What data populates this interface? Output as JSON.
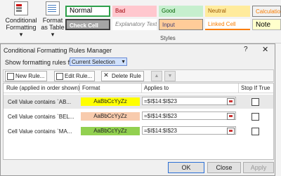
{
  "ribbon": {
    "conditional_formatting": "Conditional Formatting",
    "cf_caret": "▾",
    "format_as_table": "Format as Table",
    "ft_caret": "▾",
    "styles_group_label": "Styles",
    "styles": [
      {
        "label": "Normal",
        "bg": "#ffffff",
        "fg": "#000000",
        "border": "#2e9f4a"
      },
      {
        "label": "Bad",
        "bg": "#ffc7ce",
        "fg": "#9c0006"
      },
      {
        "label": "Good",
        "bg": "#c6efce",
        "fg": "#006100"
      },
      {
        "label": "Neutral",
        "bg": "#ffeb9c",
        "fg": "#9c5700"
      },
      {
        "label": "Calculation",
        "bg": "#f2f2f2",
        "fg": "#fa7d00"
      },
      {
        "label": "Check Cell",
        "bg": "#a5a5a5",
        "fg": "#ffffff"
      },
      {
        "label": "Explanatory Text",
        "bg": "#ffffff",
        "fg": "#7f7f7f"
      },
      {
        "label": "Input",
        "bg": "#ffcc99",
        "fg": "#3f3f76"
      },
      {
        "label": "Linked Cell",
        "bg": "#ffffff",
        "fg": "#fa7d00"
      },
      {
        "label": "Note",
        "bg": "#ffffcc",
        "fg": "#000000"
      }
    ]
  },
  "dialog": {
    "title": "Conditional Formatting Rules Manager",
    "help": "?",
    "close": "✕",
    "show_label": "Show formatting rules for:",
    "show_value": "Current Selection",
    "toolbar": {
      "new_rule": "New Rule...",
      "edit_rule": "Edit Rule...",
      "delete_rule": "Delete Rule",
      "move_up": "▲",
      "move_down": "▼"
    },
    "columns": {
      "rule": "Rule (applied in order shown)",
      "format": "Format",
      "applies_to": "Applies to",
      "stop_if_true": "Stop If True"
    },
    "rules": [
      {
        "rule": "Cell Value contains `AB...",
        "format_preview": "AaBbCcYyZz",
        "format_bg": "#ffff00",
        "applies_to": "=$I$14:$I$23",
        "stop_if_true": false
      },
      {
        "rule": "Cell Value contains `BEL...",
        "format_preview": "AaBbCcYyZz",
        "format_bg": "#f8cbad",
        "applies_to": "=$I$14:$I$23",
        "stop_if_true": false
      },
      {
        "rule": "Cell Value contains `MA...",
        "format_preview": "AaBbCcYyZz",
        "format_bg": "#92d050",
        "applies_to": "=$I$14:$I$23",
        "stop_if_true": false
      }
    ],
    "buttons": {
      "ok": "OK",
      "close": "Close",
      "apply": "Apply"
    }
  }
}
